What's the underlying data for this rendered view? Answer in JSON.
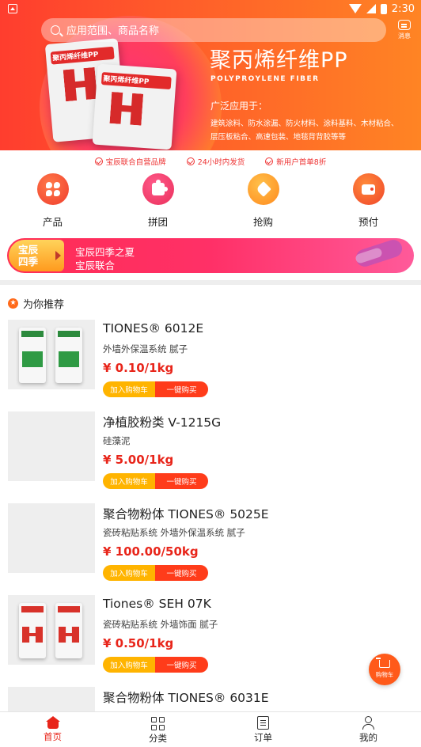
{
  "status_bar": {
    "time": "2:30"
  },
  "search": {
    "placeholder": "应用范围、商品名称"
  },
  "header": {
    "message_label": "消息"
  },
  "hero": {
    "bag_text": "聚丙烯纤维PP",
    "title": "聚丙烯纤维PP",
    "subtitle": "POLYPROYLENE FIBER",
    "applies_heading": "广泛应用于：",
    "applies_line1": "建筑涂料、防水涂漏、防火材料、涂料基料、木材粘合、",
    "applies_line2": "层压板粘合、高速包装、地毯背背胶等等"
  },
  "promises": [
    {
      "label": "宝辰联合自营品牌"
    },
    {
      "label": "24小时内发货"
    },
    {
      "label": "新用户首单8折"
    }
  ],
  "categories": [
    {
      "label": "产品",
      "icon": "grid-icon"
    },
    {
      "label": "拼团",
      "icon": "puzzle-icon"
    },
    {
      "label": "抢购",
      "icon": "tag-icon"
    },
    {
      "label": "预付",
      "icon": "wallet-icon"
    }
  ],
  "banner": {
    "badge_line1": "宝辰",
    "badge_line2": "四季",
    "line1": "宝辰四季之夏",
    "line2": "宝辰联合"
  },
  "recommend": {
    "title": "为你推荐"
  },
  "products": [
    {
      "name": "TIONES® 6012E",
      "desc": "外墙外保温系统 腻子",
      "price": "¥ 0.10/1kg",
      "image": "green-bags",
      "cart": "加入购物车",
      "buy": "一键购买"
    },
    {
      "name": "净植胶粉类 V-1215G",
      "desc": "硅藻泥",
      "price": "¥ 5.00/1kg",
      "image": "none",
      "cart": "加入购物车",
      "buy": "一键购买"
    },
    {
      "name": "聚合物粉体 TIONES® 5025E",
      "desc": "瓷砖粘贴系统 外墙外保温系统 腻子",
      "price": "¥ 100.00/50kg",
      "image": "none",
      "cart": "加入购物车",
      "buy": "一键购买"
    },
    {
      "name": "Tiones® SEH 07K",
      "desc": "瓷砖粘贴系统 外墙饰面 腻子",
      "price": "¥ 0.50/1kg",
      "image": "red-bags",
      "cart": "加入购物车",
      "buy": "一键购买"
    },
    {
      "name": "聚合物粉体 TIONES® 6031E",
      "desc": "",
      "price": "",
      "image": "none",
      "cart": "",
      "buy": ""
    }
  ],
  "float_cart": {
    "label": "购物车"
  },
  "tabbar": [
    {
      "label": "首页",
      "icon": "home-icon",
      "active": true
    },
    {
      "label": "分类",
      "icon": "category-icon",
      "active": false
    },
    {
      "label": "订单",
      "icon": "order-icon",
      "active": false
    },
    {
      "label": "我的",
      "icon": "user-icon",
      "active": false
    }
  ],
  "colors": {
    "accent": "#e8251a",
    "hero_start": "#ff3d2e",
    "hero_end": "#ff8424",
    "cart_btn": "#ffb400",
    "buy_btn": "#ff3c1a"
  }
}
